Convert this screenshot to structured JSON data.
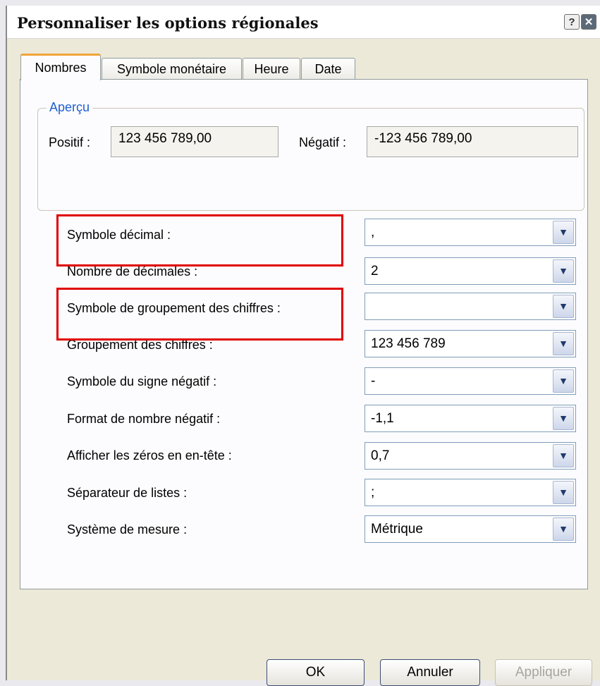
{
  "window": {
    "title": "Personnaliser les options régionales",
    "help_glyph": "?",
    "close_glyph": "✕"
  },
  "tabs": [
    {
      "label": "Nombres"
    },
    {
      "label": "Symbole monétaire"
    },
    {
      "label": "Heure"
    },
    {
      "label": "Date"
    }
  ],
  "preview": {
    "group_label": "Aperçu",
    "positive_label": "Positif :",
    "positive_value": "123 456 789,00",
    "negative_label": "Négatif :",
    "negative_value": "-123 456 789,00"
  },
  "settings": [
    {
      "label": "Symbole décimal :",
      "value": ","
    },
    {
      "label": "Nombre de décimales :",
      "value": "2"
    },
    {
      "label": "Symbole de groupement des chiffres :",
      "value": ""
    },
    {
      "label": "Groupement des chiffres :",
      "value": "123 456 789"
    },
    {
      "label": "Symbole du signe négatif :",
      "value": "-"
    },
    {
      "label": "Format de nombre négatif :",
      "value": "-1,1"
    },
    {
      "label": "Afficher les zéros en en-tête :",
      "value": "0,7"
    },
    {
      "label": "Séparateur de listes :",
      "value": ";"
    },
    {
      "label": "Système de mesure :",
      "value": "Métrique"
    }
  ],
  "buttons": {
    "ok": "OK",
    "cancel": "Annuler",
    "apply": "Appliquer"
  },
  "colors": {
    "highlight": "#e00000",
    "tab_accent": "#f1a43a",
    "group_label": "#1d5fd0"
  }
}
